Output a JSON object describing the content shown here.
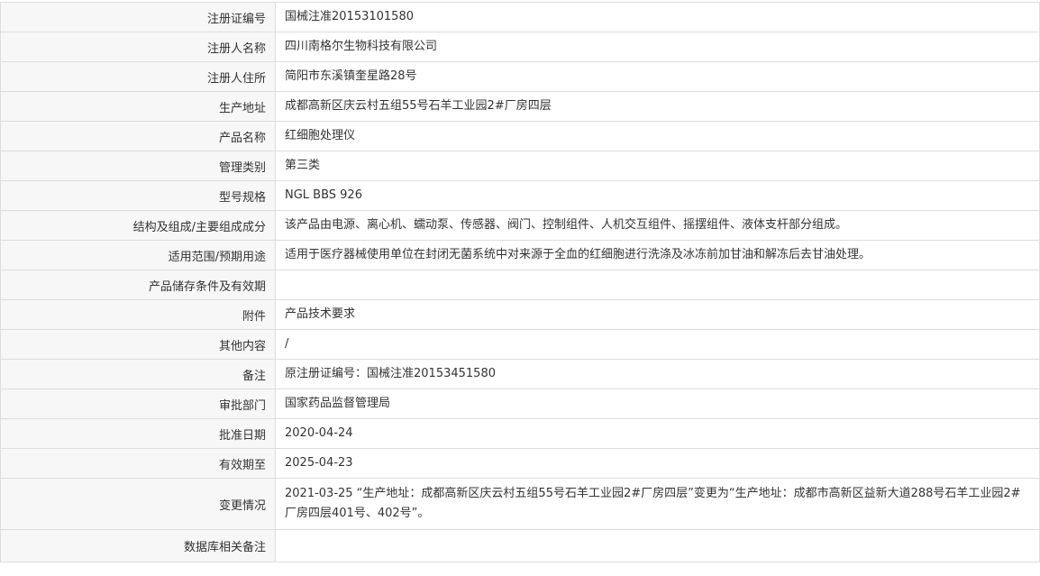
{
  "rows": [
    {
      "label": "注册证编号",
      "value": "国械注准20153101580"
    },
    {
      "label": "注册人名称",
      "value": "四川南格尔生物科技有限公司"
    },
    {
      "label": "注册人住所",
      "value": "简阳市东溪镇奎星路28号"
    },
    {
      "label": "生产地址",
      "value": "成都高新区庆云村五组55号石羊工业园2#厂房四层"
    },
    {
      "label": "产品名称",
      "value": "红细胞处理仪"
    },
    {
      "label": "管理类别",
      "value": "第三类"
    },
    {
      "label": "型号规格",
      "value": "NGL BBS 926"
    },
    {
      "label": "结构及组成/主要组成成分",
      "value": "该产品由电源、离心机、蠕动泵、传感器、阀门、控制组件、人机交互组件、摇摆组件、液体支杆部分组成。"
    },
    {
      "label": "适用范围/预期用途",
      "value": "适用于医疗器械使用单位在封闭无菌系统中对来源于全血的红细胞进行洗涤及冰冻前加甘油和解冻后去甘油处理。"
    },
    {
      "label": "产品储存条件及有效期",
      "value": ""
    },
    {
      "label": "附件",
      "value": "产品技术要求"
    },
    {
      "label": "其他内容",
      "value": "/"
    },
    {
      "label": "备注",
      "value": "原注册证编号：国械注准20153451580"
    },
    {
      "label": "审批部门",
      "value": "国家药品监督管理局"
    },
    {
      "label": "批准日期",
      "value": "2020-04-24"
    },
    {
      "label": "有效期至",
      "value": "2025-04-23"
    },
    {
      "label": "变更情况",
      "value": "2021-03-25 “生产地址：成都高新区庆云村五组55号石羊工业园2#厂房四层”变更为“生产地址：成都市高新区益新大道288号石羊工业园2#厂房四层401号、402号”。"
    },
    {
      "label": "数据库相关备注",
      "value": ""
    }
  ]
}
